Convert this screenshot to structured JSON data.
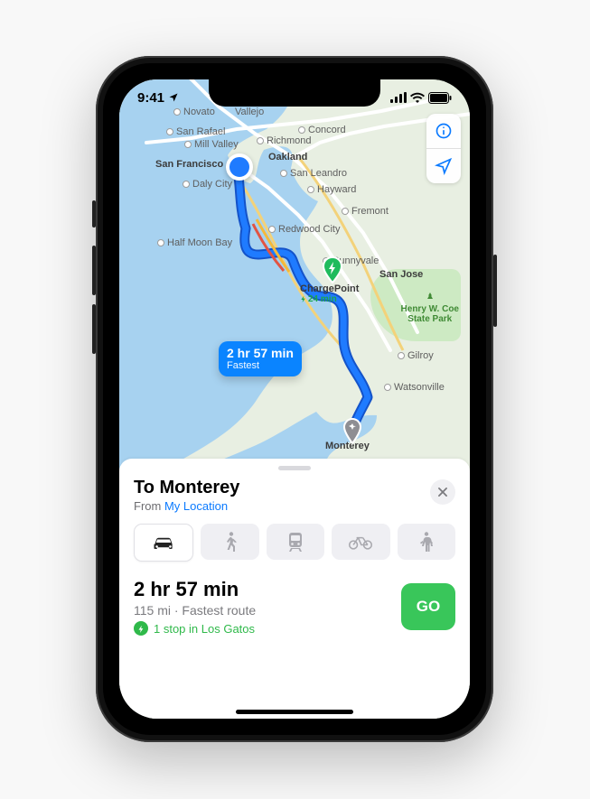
{
  "statusbar": {
    "time": "9:41"
  },
  "map": {
    "cities": {
      "novato": "Novato",
      "vallejo": "Vallejo",
      "san_rafael": "San Rafael",
      "concord": "Concord",
      "mill_valley": "Mill Valley",
      "richmond": "Richmond",
      "oakland": "Oakland",
      "san_francisco": "San Francisco",
      "daly_city": "Daly City",
      "san_leandro": "San Leandro",
      "hayward": "Hayward",
      "fremont": "Fremont",
      "redwood_city": "Redwood City",
      "half_moon_bay": "Half Moon Bay",
      "sunnyvale": "Sunnyvale",
      "san_jose": "San Jose",
      "chargepoint": "ChargePoint",
      "charge_time": "24 min",
      "gilroy": "Gilroy",
      "watsonville": "Watsonville",
      "monterey": "Monterey",
      "park_name": "Henry W. Coe\nState Park"
    },
    "route_bubble": {
      "time": "2 hr 57 min",
      "label": "Fastest"
    }
  },
  "card": {
    "title": "To Monterey",
    "from_label": "From ",
    "from_link": "My Location",
    "route": {
      "time": "2 hr 57 min",
      "details": "115 mi · Fastest route",
      "stop_text": "1 stop in Los Gatos",
      "go": "GO"
    }
  }
}
